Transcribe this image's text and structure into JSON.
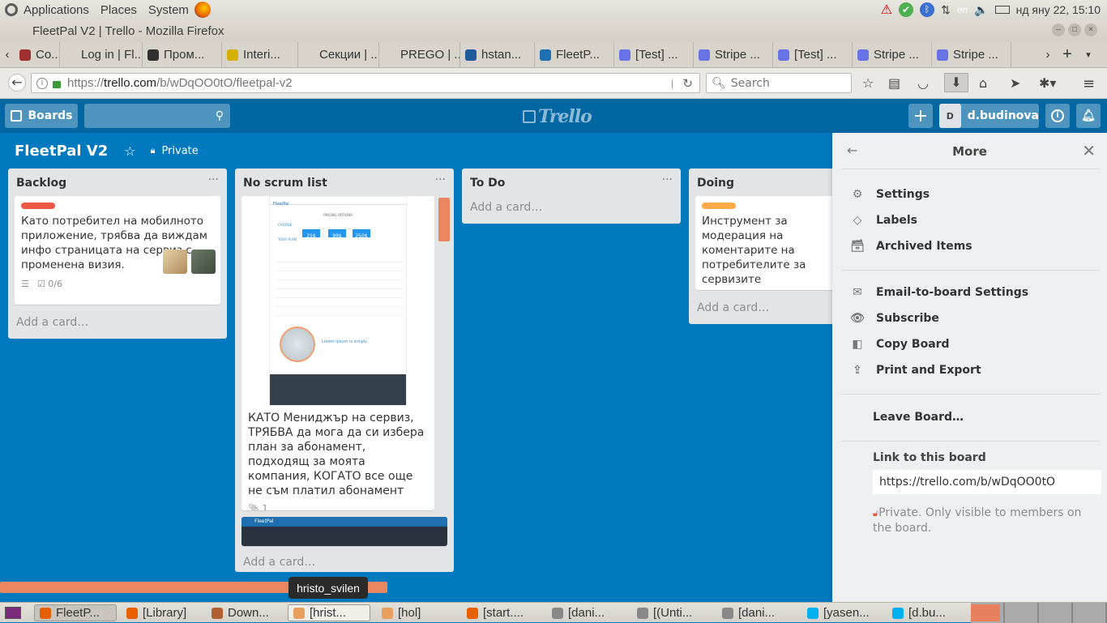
{
  "os_panel": {
    "menus": [
      "Applications",
      "Places",
      "System"
    ],
    "keyboard": "en",
    "datetime": "нд яну 22, 15:10"
  },
  "window": {
    "title": "FleetPal V2 | Trello - Mozilla Firefox"
  },
  "tabs": [
    {
      "label": "Co...",
      "color": "#a03030"
    },
    {
      "label": "Log in | Fl...",
      "color": "#d8d4cc"
    },
    {
      "label": "Пром...",
      "color": "#303030"
    },
    {
      "label": "Interi...",
      "color": "#d6b000"
    },
    {
      "label": "Секции | ...",
      "color": "#d8d4cc"
    },
    {
      "label": "PREGO | ...",
      "color": "#d8d4cc"
    },
    {
      "label": "hstan...",
      "color": "#1f5a9a"
    },
    {
      "label": "FleetP...",
      "color": "#1f6fb0"
    },
    {
      "label": "[Test] ...",
      "color": "#6772e5"
    },
    {
      "label": "Stripe ...",
      "color": "#6772e5"
    },
    {
      "label": "[Test] ...",
      "color": "#6772e5"
    },
    {
      "label": "Stripe ...",
      "color": "#6772e5"
    },
    {
      "label": "Stripe ...",
      "color": "#6772e5"
    }
  ],
  "nav": {
    "url_prefix": "https://",
    "url_host": "trello.com",
    "url_path": "/b/wDqOO0tO/fleetpal-v2",
    "search_placeholder": "Search"
  },
  "trello_header": {
    "boards_label": "Boards",
    "logo": "Trello",
    "user_initial": "D",
    "username": "d.budinova"
  },
  "board": {
    "title": "FleetPal V2",
    "visibility": "Private"
  },
  "lists": [
    {
      "title": "Backlog",
      "card_text": "Като потребител на мобилното приложение, трябва да виждам инфо страницата на сервиз с променена визия.",
      "checklist": "0/6",
      "add_card": "Add a card…"
    },
    {
      "title": "No scrum list",
      "preview_brand": "FleetPal",
      "preview_heading": "PRICING OPTIONS",
      "preview_plan_title": "CHOOSE YOUR PLAN",
      "preview_prices": [
        "25$",
        "99$",
        "250$"
      ],
      "preview_lorem": "Lorem Ipsum is simply",
      "card_text": "КАТО Мениджър на сервиз, ТРЯБВА да мога да си избера план за абонамент, подходящ за моята компания, КОГАТО все още не съм платил абонамент",
      "attachments": "1",
      "second_preview_brand": "FleetPal",
      "add_card": "Add a card…"
    },
    {
      "title": "To Do",
      "add_card": "Add a card…"
    },
    {
      "title": "Doing",
      "card_text": "Инструмент за модерация на коментарите на потребителите за сервизите",
      "add_card": "Add a card…"
    }
  ],
  "menu": {
    "title": "More",
    "items_a": [
      "Settings",
      "Labels",
      "Archived Items"
    ],
    "items_b": [
      "Email-to-board Settings",
      "Subscribe",
      "Copy Board",
      "Print and Export"
    ],
    "leave": "Leave Board…",
    "link_heading": "Link to this board",
    "link_value": "https://trello.com/b/wDqOO0tO",
    "private_note": "Private. Only visible to members on the board."
  },
  "tooltip": "hristo_svilen",
  "taskbar": [
    {
      "label": "FleetP...",
      "color": "#e66000"
    },
    {
      "label": "[Library]",
      "color": "#e66000"
    },
    {
      "label": "Down...",
      "color": "#b06030"
    },
    {
      "label": "[hrist...",
      "color": "#e8a060"
    },
    {
      "label": "[hol]",
      "color": "#e8a060"
    },
    {
      "label": "[start....",
      "color": "#e66000"
    },
    {
      "label": "[dani...",
      "color": "#888888"
    },
    {
      "label": "[(Unti...",
      "color": "#888888"
    },
    {
      "label": "[dani...",
      "color": "#888888"
    },
    {
      "label": "[yasen...",
      "color": "#00aff0"
    },
    {
      "label": "[d.bu...",
      "color": "#00aff0"
    }
  ],
  "colors": {
    "board_bg": "#0079bf",
    "header_bg": "#0067a3",
    "label_red": "#eb5a46",
    "label_orange": "#ffab4a",
    "scroll_orange": "#e8875f"
  }
}
